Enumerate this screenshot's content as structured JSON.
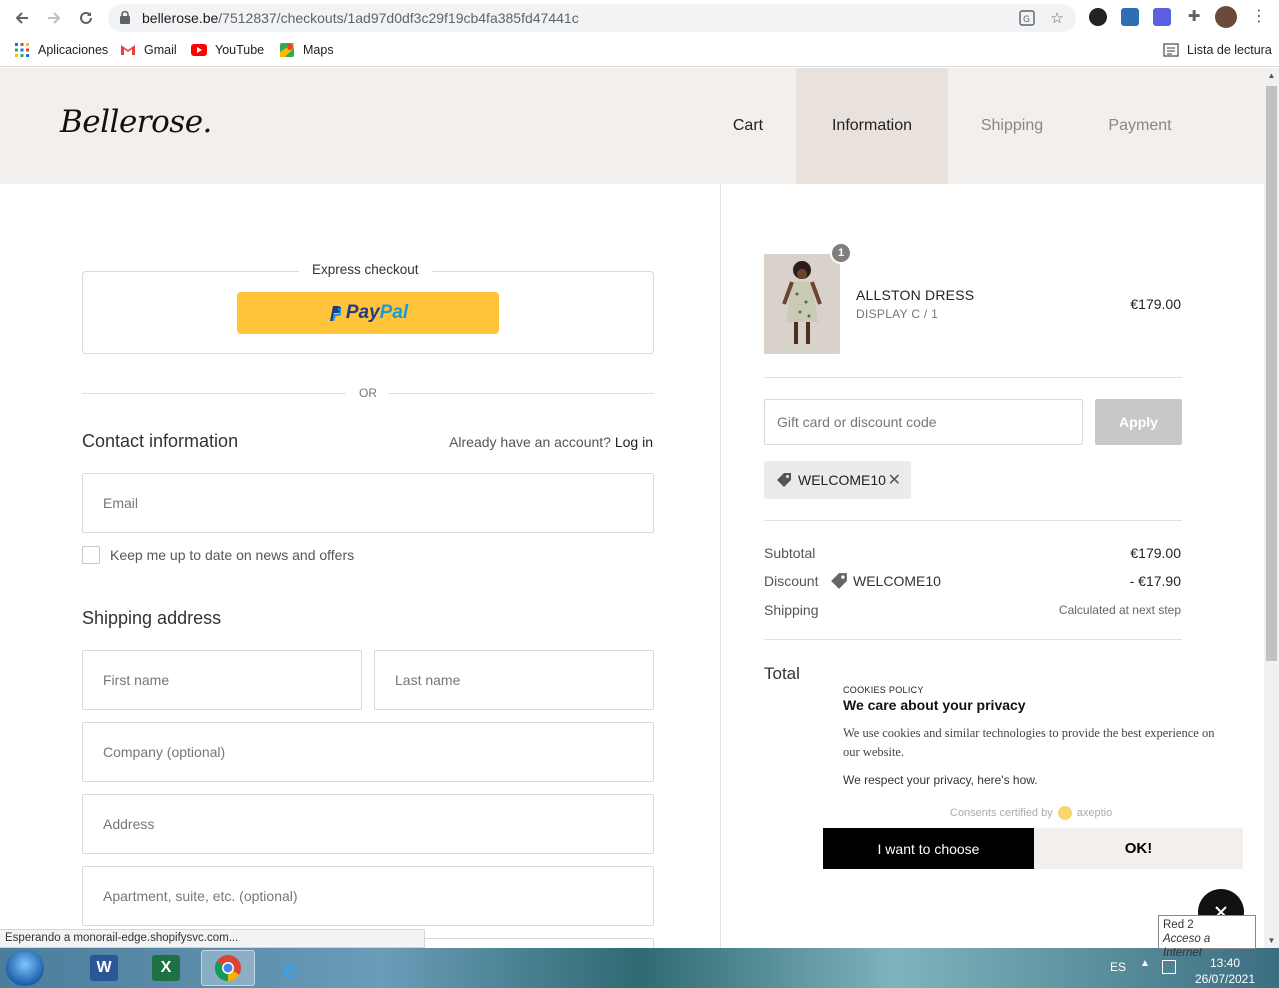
{
  "browser": {
    "url_domain": "bellerose.be",
    "url_path": "/7512837/checkouts/1ad97d0df3c29f19cb4fa385fd47441c",
    "bookmarks": [
      {
        "label": "Aplicaciones",
        "icon": "apps-grid-icon"
      },
      {
        "label": "Gmail",
        "icon": "gmail-icon"
      },
      {
        "label": "YouTube",
        "icon": "youtube-icon"
      },
      {
        "label": "Maps",
        "icon": "maps-icon"
      }
    ],
    "reading_list": "Lista de lectura",
    "status_text": "Esperando a monorail-edge.shopifysvc.com..."
  },
  "header": {
    "logo": "Bellerose.",
    "steps": [
      "Cart",
      "Information",
      "Shipping",
      "Payment"
    ],
    "active_step": "Information"
  },
  "express": {
    "title": "Express checkout",
    "paypal_part1": "Pay",
    "paypal_part2": "Pal",
    "or_text": "OR"
  },
  "contact": {
    "heading": "Contact information",
    "account_prompt": "Already have an account?",
    "login_label": "Log in",
    "email_placeholder": "Email",
    "newsletter_label": "Keep me up to date on news and offers"
  },
  "shipping_address": {
    "heading": "Shipping address",
    "first_name": "First name",
    "last_name": "Last name",
    "company": "Company (optional)",
    "address": "Address",
    "apartment": "Apartment, suite, etc. (optional)"
  },
  "order": {
    "quantity": "1",
    "product_name": "ALLSTON DRESS",
    "product_variant": "DISPLAY C / 1",
    "product_price": "€179.00",
    "discount_placeholder": "Gift card or discount code",
    "apply_label": "Apply",
    "applied_code": "WELCOME10",
    "subtotal_label": "Subtotal",
    "subtotal_value": "€179.00",
    "discount_label": "Discount",
    "discount_code": "WELCOME10",
    "discount_value": "- €17.90",
    "shipping_label": "Shipping",
    "shipping_value": "Calculated at next step",
    "total_label": "Total"
  },
  "cookie": {
    "small_title": "COOKIES POLICY",
    "title": "We care about your privacy",
    "body": "We use cookies and similar technologies to provide the best experience on our website.",
    "link": "We respect your privacy, here's how.",
    "certified": "Consents certified by",
    "certifier": "axeptio",
    "choose_label": "I want to choose",
    "ok_label": "OK!"
  },
  "taskbar": {
    "lang": "ES",
    "time": "13:40",
    "date": "26/07/2021",
    "network_tip_line1": "Red  2",
    "network_tip_line2": "Acceso a Internet"
  }
}
